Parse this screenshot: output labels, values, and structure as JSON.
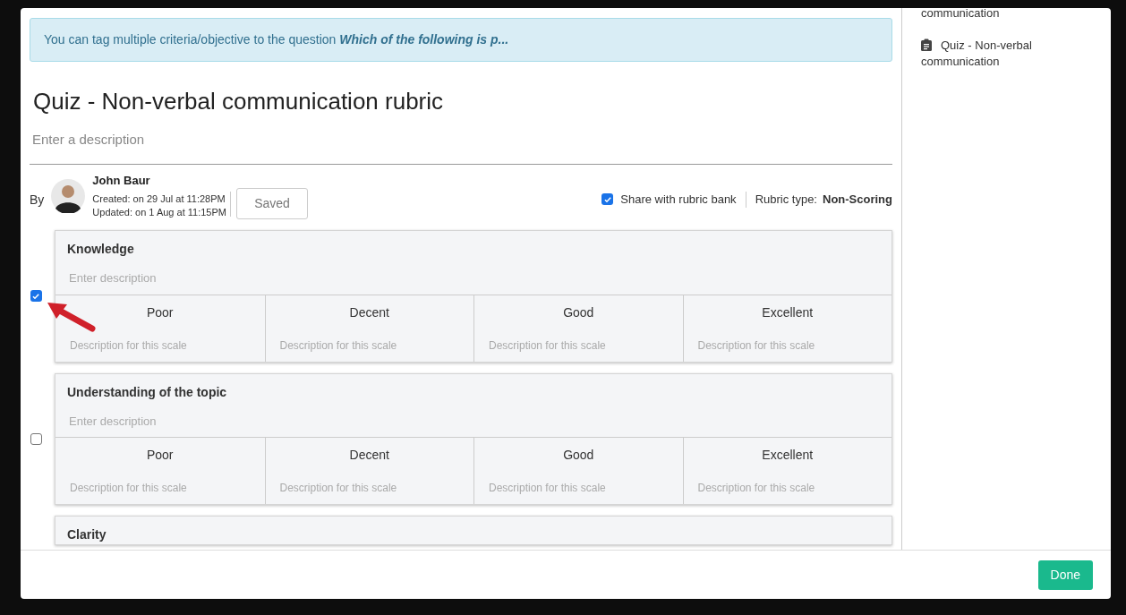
{
  "banner": {
    "text": "You can tag multiple criteria/objective to the question",
    "question": "Which of the following is p..."
  },
  "rubric": {
    "title": "Quiz - Non-verbal communication rubric",
    "description_placeholder": "Enter a description"
  },
  "author": {
    "by": "By",
    "name": "John Baur",
    "created": "Created: on 29 Jul at 11:28PM",
    "updated": "Updated: on 1 Aug at 11:15PM",
    "status": "Saved"
  },
  "share": {
    "label": "Share with rubric bank",
    "checked": true
  },
  "rubric_type": {
    "label": "Rubric type:",
    "value": "Non-Scoring"
  },
  "criteria": [
    {
      "title": "Knowledge",
      "description_placeholder": "Enter description",
      "checked": true,
      "annotated": true,
      "scales": [
        {
          "label": "Poor",
          "placeholder": "Description for this scale"
        },
        {
          "label": "Decent",
          "placeholder": "Description for this scale"
        },
        {
          "label": "Good",
          "placeholder": "Description for this scale"
        },
        {
          "label": "Excellent",
          "placeholder": "Description for this scale"
        }
      ]
    },
    {
      "title": "Understanding of the topic",
      "description_placeholder": "Enter description",
      "checked": false,
      "annotated": false,
      "scales": [
        {
          "label": "Poor",
          "placeholder": "Description for this scale"
        },
        {
          "label": "Decent",
          "placeholder": "Description for this scale"
        },
        {
          "label": "Good",
          "placeholder": "Description for this scale"
        },
        {
          "label": "Excellent",
          "placeholder": "Description for this scale"
        }
      ]
    },
    {
      "title": "Clarity"
    }
  ],
  "sidebar": {
    "items": [
      {
        "title": "communication",
        "icon": false
      },
      {
        "title": "Quiz - Non-verbal communication",
        "icon": true
      }
    ]
  },
  "footer": {
    "done": "Done"
  }
}
